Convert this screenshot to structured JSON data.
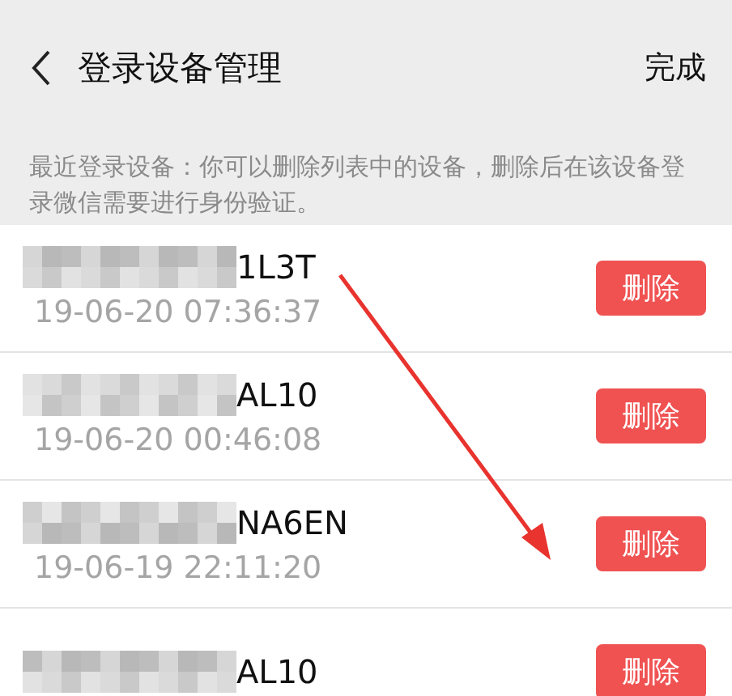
{
  "header": {
    "title": "登录设备管理",
    "action": "完成"
  },
  "notice": "最近登录设备：你可以删除列表中的设备，删除后在该设备登录微信需要进行身份验证。",
  "devices": [
    {
      "name": "1L3T",
      "time": "19-06-20 07:36:37",
      "button": "删除"
    },
    {
      "name": "AL10",
      "time": "19-06-20 00:46:08",
      "button": "删除"
    },
    {
      "name": "NA6EN",
      "time": "19-06-19 22:11:20",
      "button": "删除"
    },
    {
      "name": "AL10",
      "button": "删除"
    }
  ]
}
